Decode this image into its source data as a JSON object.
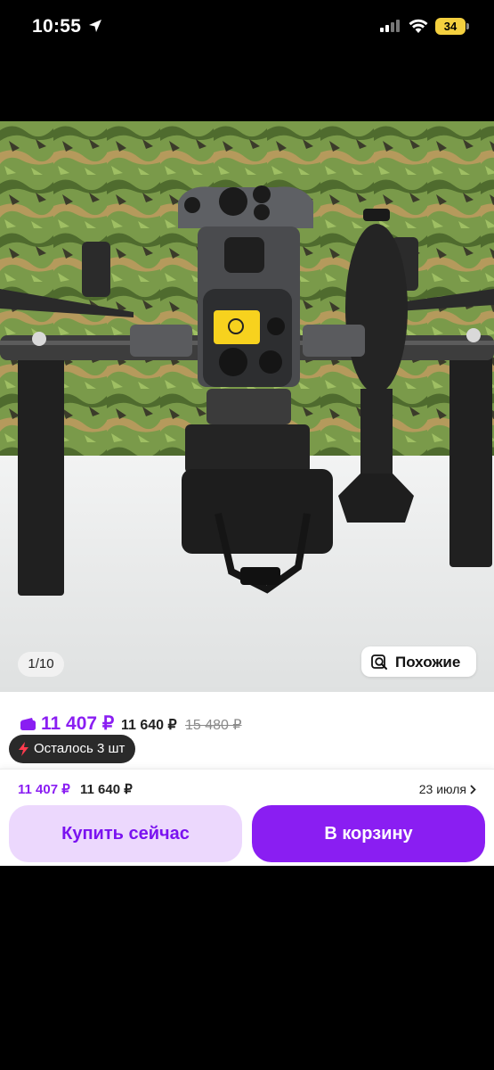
{
  "status_bar": {
    "time": "10:55",
    "battery": "34"
  },
  "gallery": {
    "counter": "1/10",
    "similar_label": "Похожие"
  },
  "price": {
    "current": "11 407 ₽",
    "secondary": "11 640 ₽",
    "old": "15 480 ₽"
  },
  "stock_badge": "Осталось 3 шт",
  "bottom_bar": {
    "price_current": "11 407 ₽",
    "price_secondary": "11 640 ₽",
    "delivery_date": "23 июля",
    "buy_now_label": "Купить сейчас",
    "add_to_cart_label": "В корзину"
  },
  "colors": {
    "accent": "#8a1ef2",
    "accent_light": "#ecd8fd",
    "badge_bg": "#2a2a2a"
  }
}
